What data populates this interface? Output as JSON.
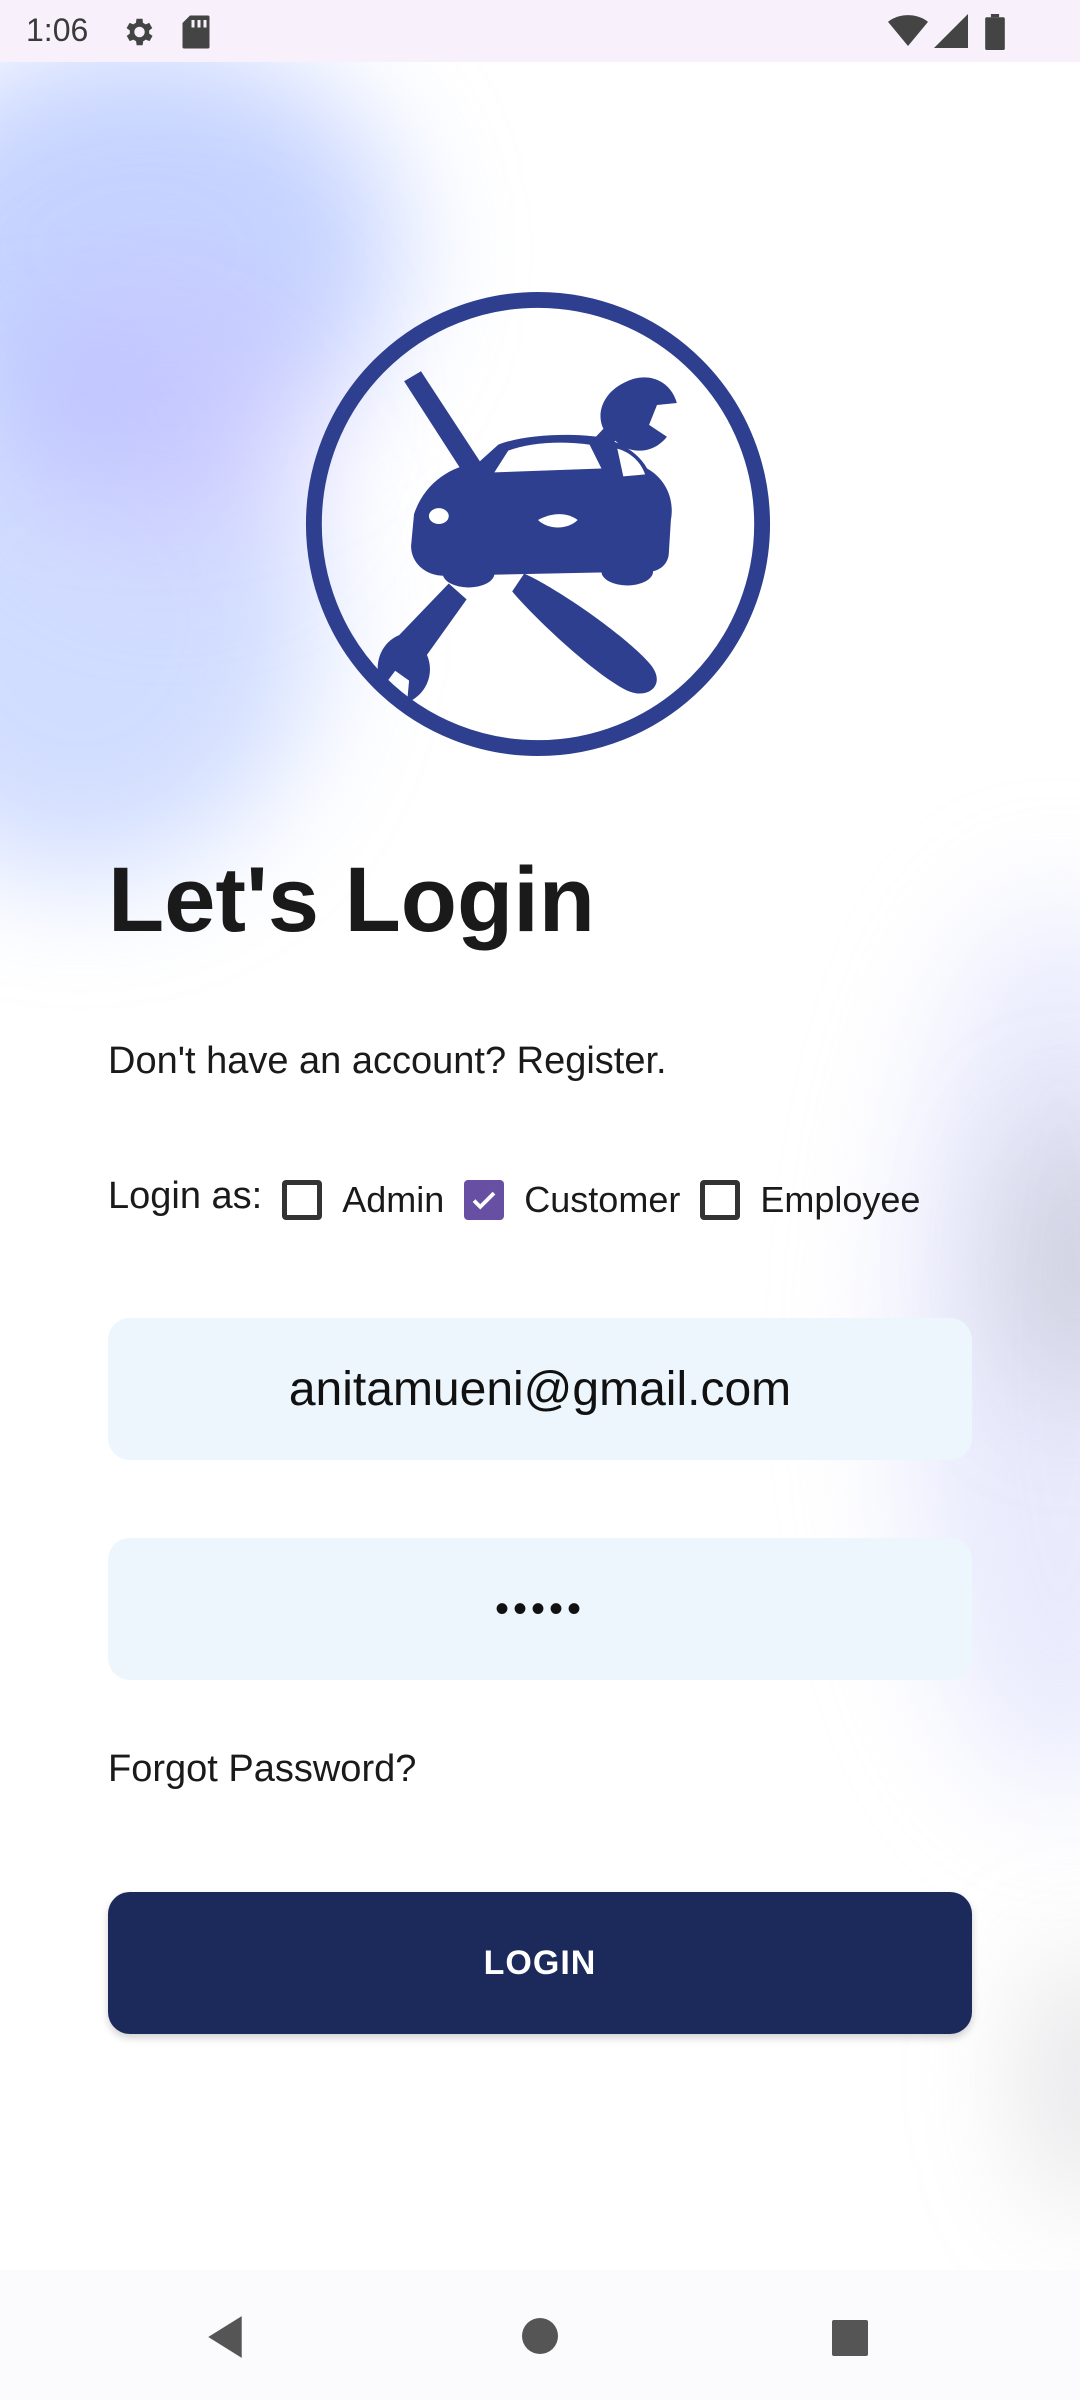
{
  "status_bar": {
    "time": "1:06",
    "icons": [
      "settings-icon",
      "sd-card-icon",
      "wifi-icon",
      "signal-icon",
      "battery-icon"
    ]
  },
  "logo": {
    "icon": "car-repair-logo",
    "color": "#2e3f8f"
  },
  "login": {
    "title": "Let's Login",
    "register_prompt": "Don't have an account? Register.",
    "login_as_label": "Login as:",
    "roles": [
      {
        "label": "Admin",
        "checked": false
      },
      {
        "label": "Customer",
        "checked": true
      },
      {
        "label": "Employee",
        "checked": false
      }
    ],
    "email_value": "anitamueni@gmail.com",
    "password_value": "•••••",
    "forgot_password": "Forgot Password?",
    "login_button": "LOGIN"
  },
  "nav_bar": {
    "icons": [
      "back-icon",
      "home-icon",
      "recents-icon"
    ]
  },
  "colors": {
    "primary": "#1b2a5a",
    "checkbox_accent": "#6750a4",
    "field_bg": "#edf6fd",
    "logo": "#2e3f8f"
  }
}
